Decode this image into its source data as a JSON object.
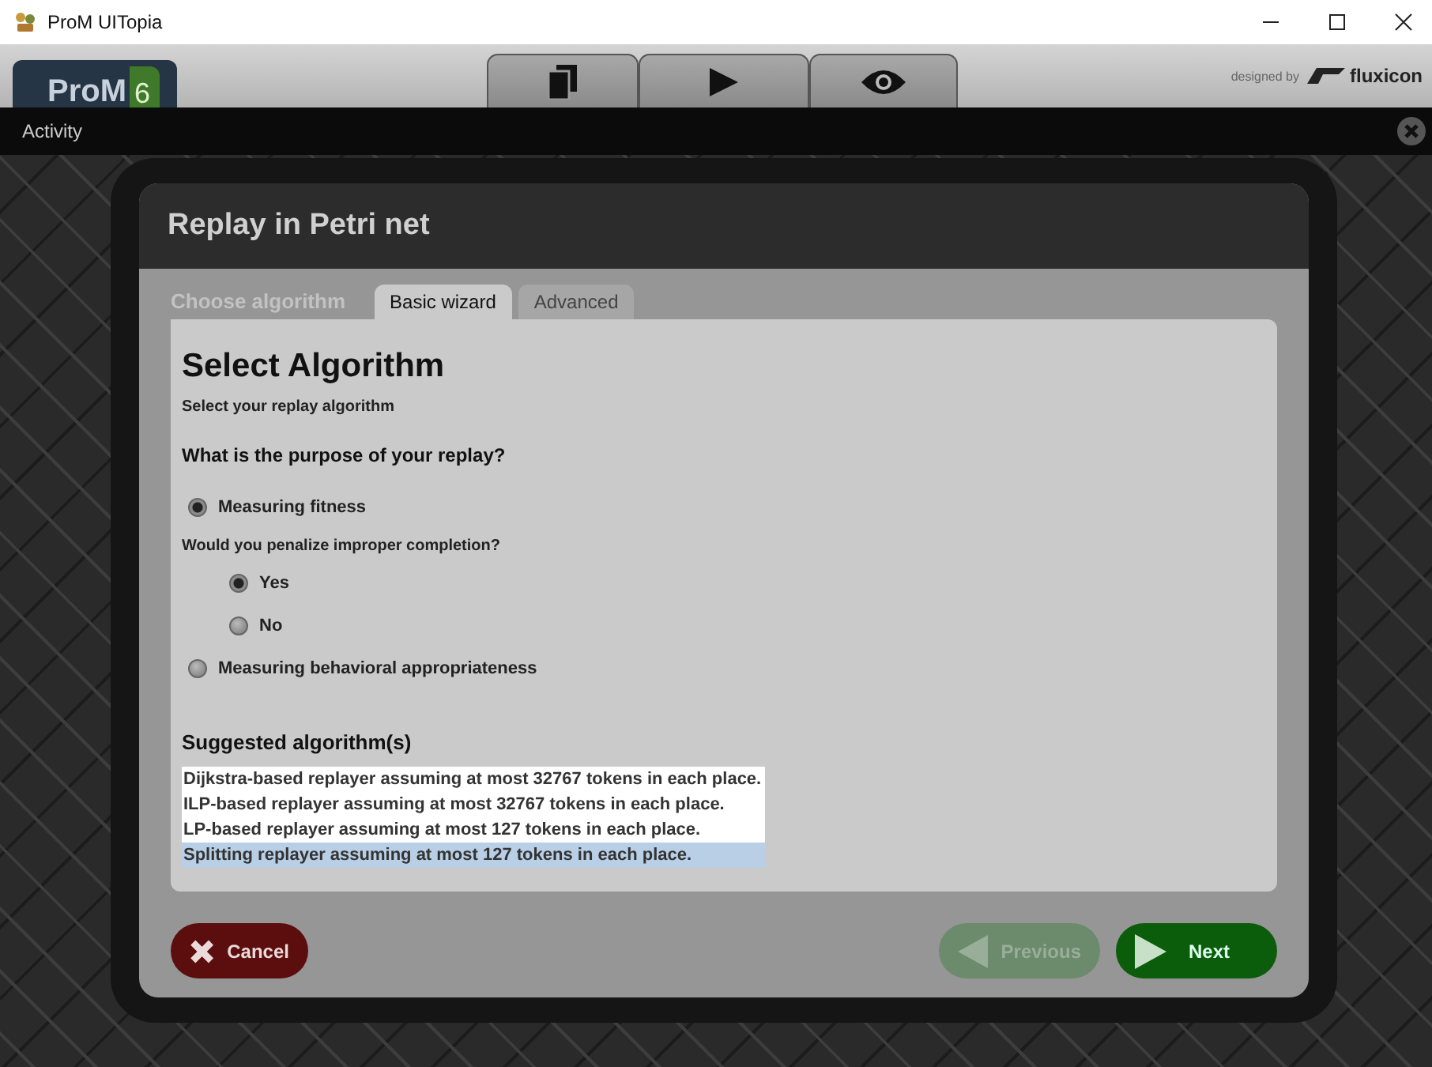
{
  "window": {
    "title": "ProM UITopia"
  },
  "toolbar": {
    "logo": {
      "name": "ProM",
      "version": "6"
    },
    "tabs": [
      {
        "kind": "copy"
      },
      {
        "kind": "play"
      },
      {
        "kind": "eye"
      }
    ],
    "credit": "designed by",
    "brand": "fluxicon"
  },
  "activity_bar": {
    "title": "Activity"
  },
  "dialog": {
    "title": "Replay in Petri net",
    "step_label": "Choose algorithm",
    "tabs": [
      {
        "label": "Basic wizard",
        "selected": true
      },
      {
        "label": "Advanced",
        "selected": false
      }
    ],
    "heading": "Select Algorithm",
    "subheading": "Select your replay algorithm",
    "question": "What is the purpose of your replay?",
    "options": [
      {
        "label": "Measuring fitness",
        "selected": true,
        "follow_up": {
          "question": "Would you penalize improper completion?",
          "options": [
            {
              "label": "Yes",
              "selected": true
            },
            {
              "label": "No",
              "selected": false
            }
          ]
        }
      },
      {
        "label": "Measuring behavioral appropriateness",
        "selected": false
      }
    ],
    "suggested": {
      "heading": "Suggested algorithm(s)",
      "items": [
        {
          "label": "Dijkstra-based replayer assuming at most 32767 tokens in each place.",
          "selected": false
        },
        {
          "label": "ILP-based replayer assuming at most 32767 tokens in each place.",
          "selected": false
        },
        {
          "label": "LP-based replayer assuming at most 127 tokens in each place.",
          "selected": false
        },
        {
          "label": "Splitting replayer assuming at most 127 tokens in each place.",
          "selected": true
        }
      ]
    },
    "buttons": [
      {
        "kind": "cancel",
        "label": "Cancel",
        "disabled": false
      },
      {
        "kind": "previous",
        "label": "Previous",
        "disabled": true
      },
      {
        "kind": "next",
        "label": "Next",
        "disabled": false
      }
    ]
  }
}
